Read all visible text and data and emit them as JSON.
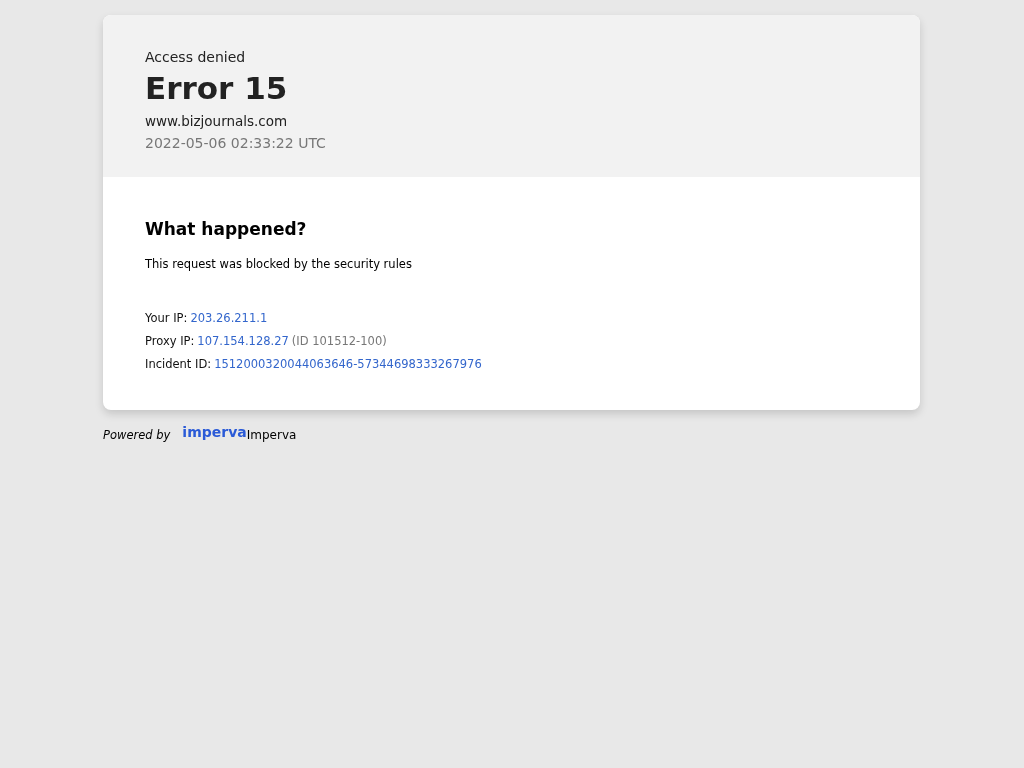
{
  "header": {
    "eyebrow": "Access denied",
    "title": "Error 15",
    "host": "www.bizjournals.com",
    "timestamp": "2022-05-06 02:33:22 UTC"
  },
  "body": {
    "heading": "What happened?",
    "message": "This request was blocked by the security rules",
    "details": [
      {
        "label": "Your IP:",
        "value": "203.26.211.1"
      },
      {
        "label": "Proxy IP:",
        "value": "107.154.128.27",
        "note": "(ID 101512-100)"
      },
      {
        "label": "Incident ID:",
        "value": "1512000320044063646-57344698333267976"
      }
    ]
  },
  "footer": {
    "powered_by": "Powered by",
    "logo": "imperva",
    "brand": "Imperva"
  }
}
